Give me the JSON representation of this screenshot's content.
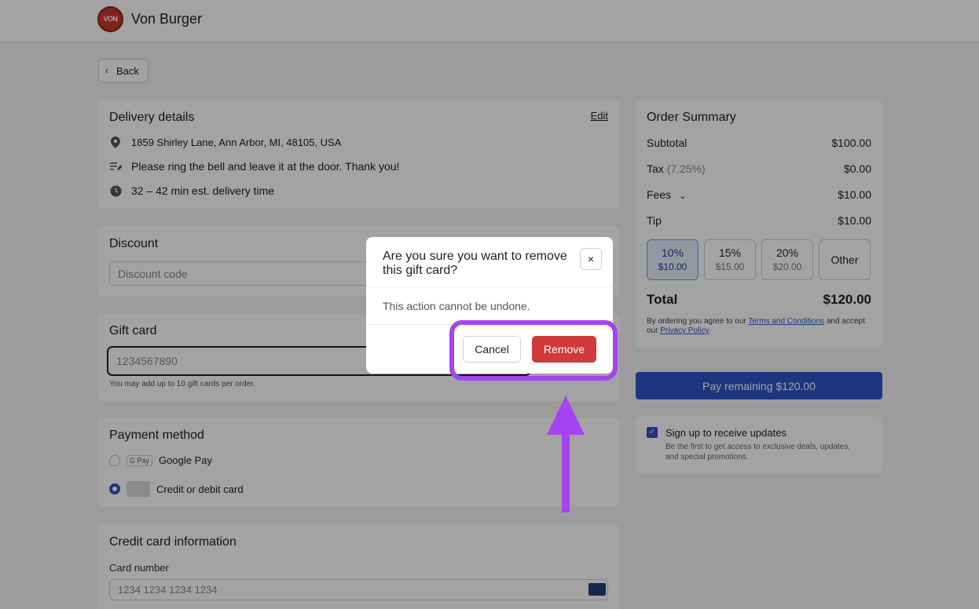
{
  "header": {
    "logo_text": "VON",
    "brand": "Von Burger"
  },
  "nav": {
    "back_label": "Back"
  },
  "delivery": {
    "title": "Delivery details",
    "edit_label": "Edit",
    "address": "1859 Shirley Lane, Ann Arbor, MI, 48105, USA",
    "note": "Please ring the bell and leave it at the door. Thank you!",
    "eta": "32 – 42 min est. delivery time"
  },
  "discount": {
    "title": "Discount",
    "placeholder": "Discount code"
  },
  "gift_card": {
    "title": "Gift card",
    "placeholder": "1234567890",
    "hint": "You may add up to 10 gift cards per order."
  },
  "payment": {
    "title": "Payment method",
    "options": [
      {
        "label": "Google Pay",
        "badge": "G Pay",
        "selected": false
      },
      {
        "label": "Credit or debit card",
        "selected": true
      }
    ]
  },
  "credit_card": {
    "title": "Credit card information",
    "number_label": "Card number",
    "number_placeholder": "1234 1234 1234 1234"
  },
  "summary": {
    "title": "Order Summary",
    "subtotal_label": "Subtotal",
    "subtotal_value": "$100.00",
    "tax_label": "Tax",
    "tax_rate": "(7.25%)",
    "tax_value": "$0.00",
    "fees_label": "Fees",
    "fees_value": "$10.00",
    "tip_label": "Tip",
    "tip_value": "$10.00",
    "tip_options": [
      {
        "pct": "10%",
        "amt": "$10.00",
        "selected": true
      },
      {
        "pct": "15%",
        "amt": "$15.00",
        "selected": false
      },
      {
        "pct": "20%",
        "amt": "$20.00",
        "selected": false
      },
      {
        "pct": "Other",
        "amt": "",
        "selected": false
      }
    ],
    "total_label": "Total",
    "total_value": "$120.00",
    "legal_prefix": "By ordering you agree to our ",
    "terms_link": "Terms and Conditions",
    "legal_mid": " and accept our ",
    "privacy_link": "Privacy Policy"
  },
  "pay_button": "Pay remaining $120.00",
  "updates": {
    "checkbox_label": "Sign up to receive updates",
    "checked": true,
    "description": "Be the first to get access to exclusive deals, updates, and special promotions."
  },
  "modal": {
    "title": "Are you sure you want to remove this gift card?",
    "body": "This action cannot be undone.",
    "cancel_label": "Cancel",
    "remove_label": "Remove",
    "close_glyph": "×"
  },
  "colors": {
    "accent": "#2d56c7",
    "danger": "#d13a3a",
    "highlight": "#a543f0"
  }
}
